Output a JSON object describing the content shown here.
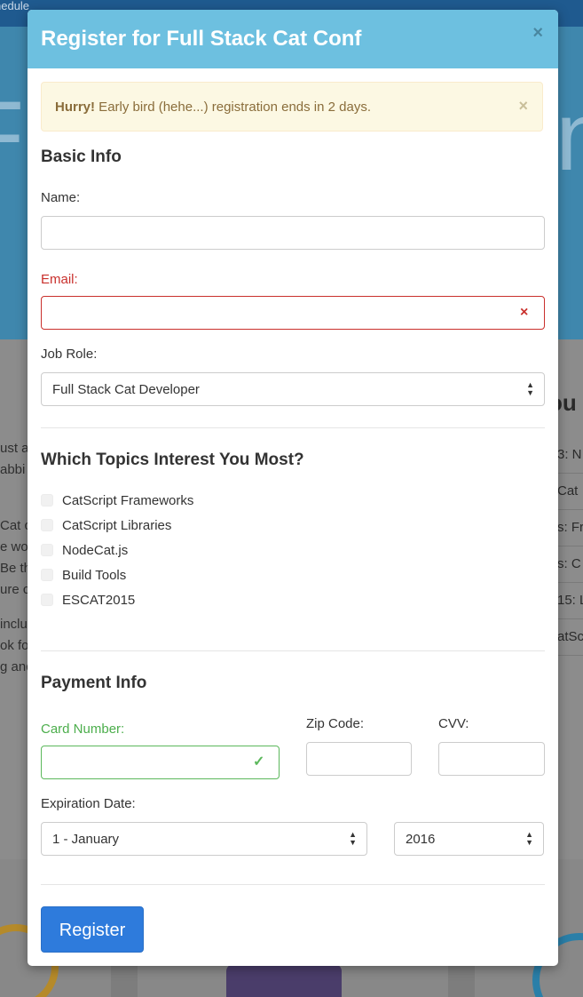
{
  "background": {
    "topbar_text": "nedule",
    "hero_left": "Fu",
    "hero_right": "n",
    "left_fragments": [
      "ust a",
      "abbi",
      "Cat c",
      "e wo",
      "Be th",
      "ure c",
      "inclu",
      "ok fo",
      "g and"
    ],
    "right_heading": "ou",
    "right_items": [
      "3: N",
      "Cat",
      "s: Fr",
      "s: C",
      "15: L",
      "atSc"
    ]
  },
  "modal": {
    "title": "Register for Full Stack Cat Conf",
    "close_symbol": "×"
  },
  "alert": {
    "strong": "Hurry!",
    "text": " Early bird (hehe...) registration ends in 2 days.",
    "close_symbol": "×"
  },
  "basic_info": {
    "heading": "Basic Info",
    "name_label": "Name:",
    "name_value": "",
    "email_label": "Email:",
    "email_value": "",
    "email_status_icon": "×",
    "job_role_label": "Job Role:",
    "job_role_selected": "Full Stack Cat Developer"
  },
  "topics": {
    "heading": "Which Topics Interest You Most?",
    "items": [
      "CatScript Frameworks",
      "CatScript Libraries",
      "NodeCat.js",
      "Build Tools",
      "ESCAT2015"
    ]
  },
  "payment": {
    "heading": "Payment Info",
    "card_label": "Card Number:",
    "card_value": "",
    "card_status_icon": "✓",
    "zip_label": "Zip Code:",
    "zip_value": "",
    "cvv_label": "CVV:",
    "cvv_value": "",
    "expiration_label": "Expiration Date:",
    "month_selected": "1 - January",
    "year_selected": "2016"
  },
  "submit": {
    "label": "Register"
  },
  "colors": {
    "header_bg": "#6dc0e0",
    "alert_bg": "#fcf8e3",
    "error": "#c9302c",
    "success": "#5cb85c",
    "primary": "#2e7bdc"
  }
}
